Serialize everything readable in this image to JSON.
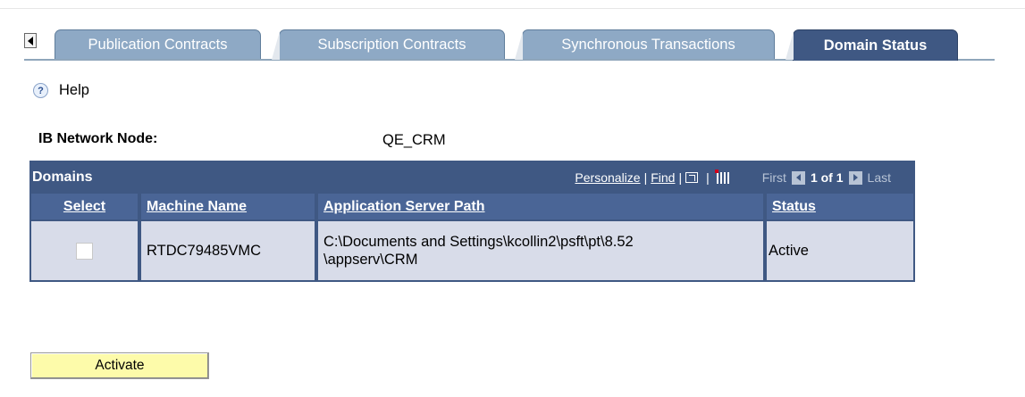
{
  "tabs": [
    {
      "label": "Publication Contracts"
    },
    {
      "label": "Subscription Contracts"
    },
    {
      "label": "Synchronous Transactions"
    },
    {
      "label": "Domain Status"
    }
  ],
  "help": {
    "label": "Help"
  },
  "node": {
    "label": "IB Network Node:",
    "value": "QE_CRM"
  },
  "grid": {
    "title": "Domains",
    "nav": {
      "personalize": "Personalize",
      "sep": "|",
      "find": "Find",
      "first": "First",
      "count": "1 of 1",
      "last": "Last"
    },
    "columns": [
      "Select",
      "Machine Name",
      "Application Server Path",
      "Status"
    ],
    "rows": [
      {
        "selected": false,
        "machine": "RTDC79485VMC",
        "path_line1": "C:\\Documents and Settings\\kcollin2\\psft\\pt\\8.52",
        "path_line2": "\\appserv\\CRM",
        "status": "Active"
      }
    ]
  },
  "buttons": {
    "activate": "Activate"
  },
  "colors": {
    "tab_inactive": "#8ea9c5",
    "tab_active": "#3f5883",
    "grid_header": "#3f5883",
    "row_bg": "#d8dce9",
    "button": "#fdfbaa"
  }
}
